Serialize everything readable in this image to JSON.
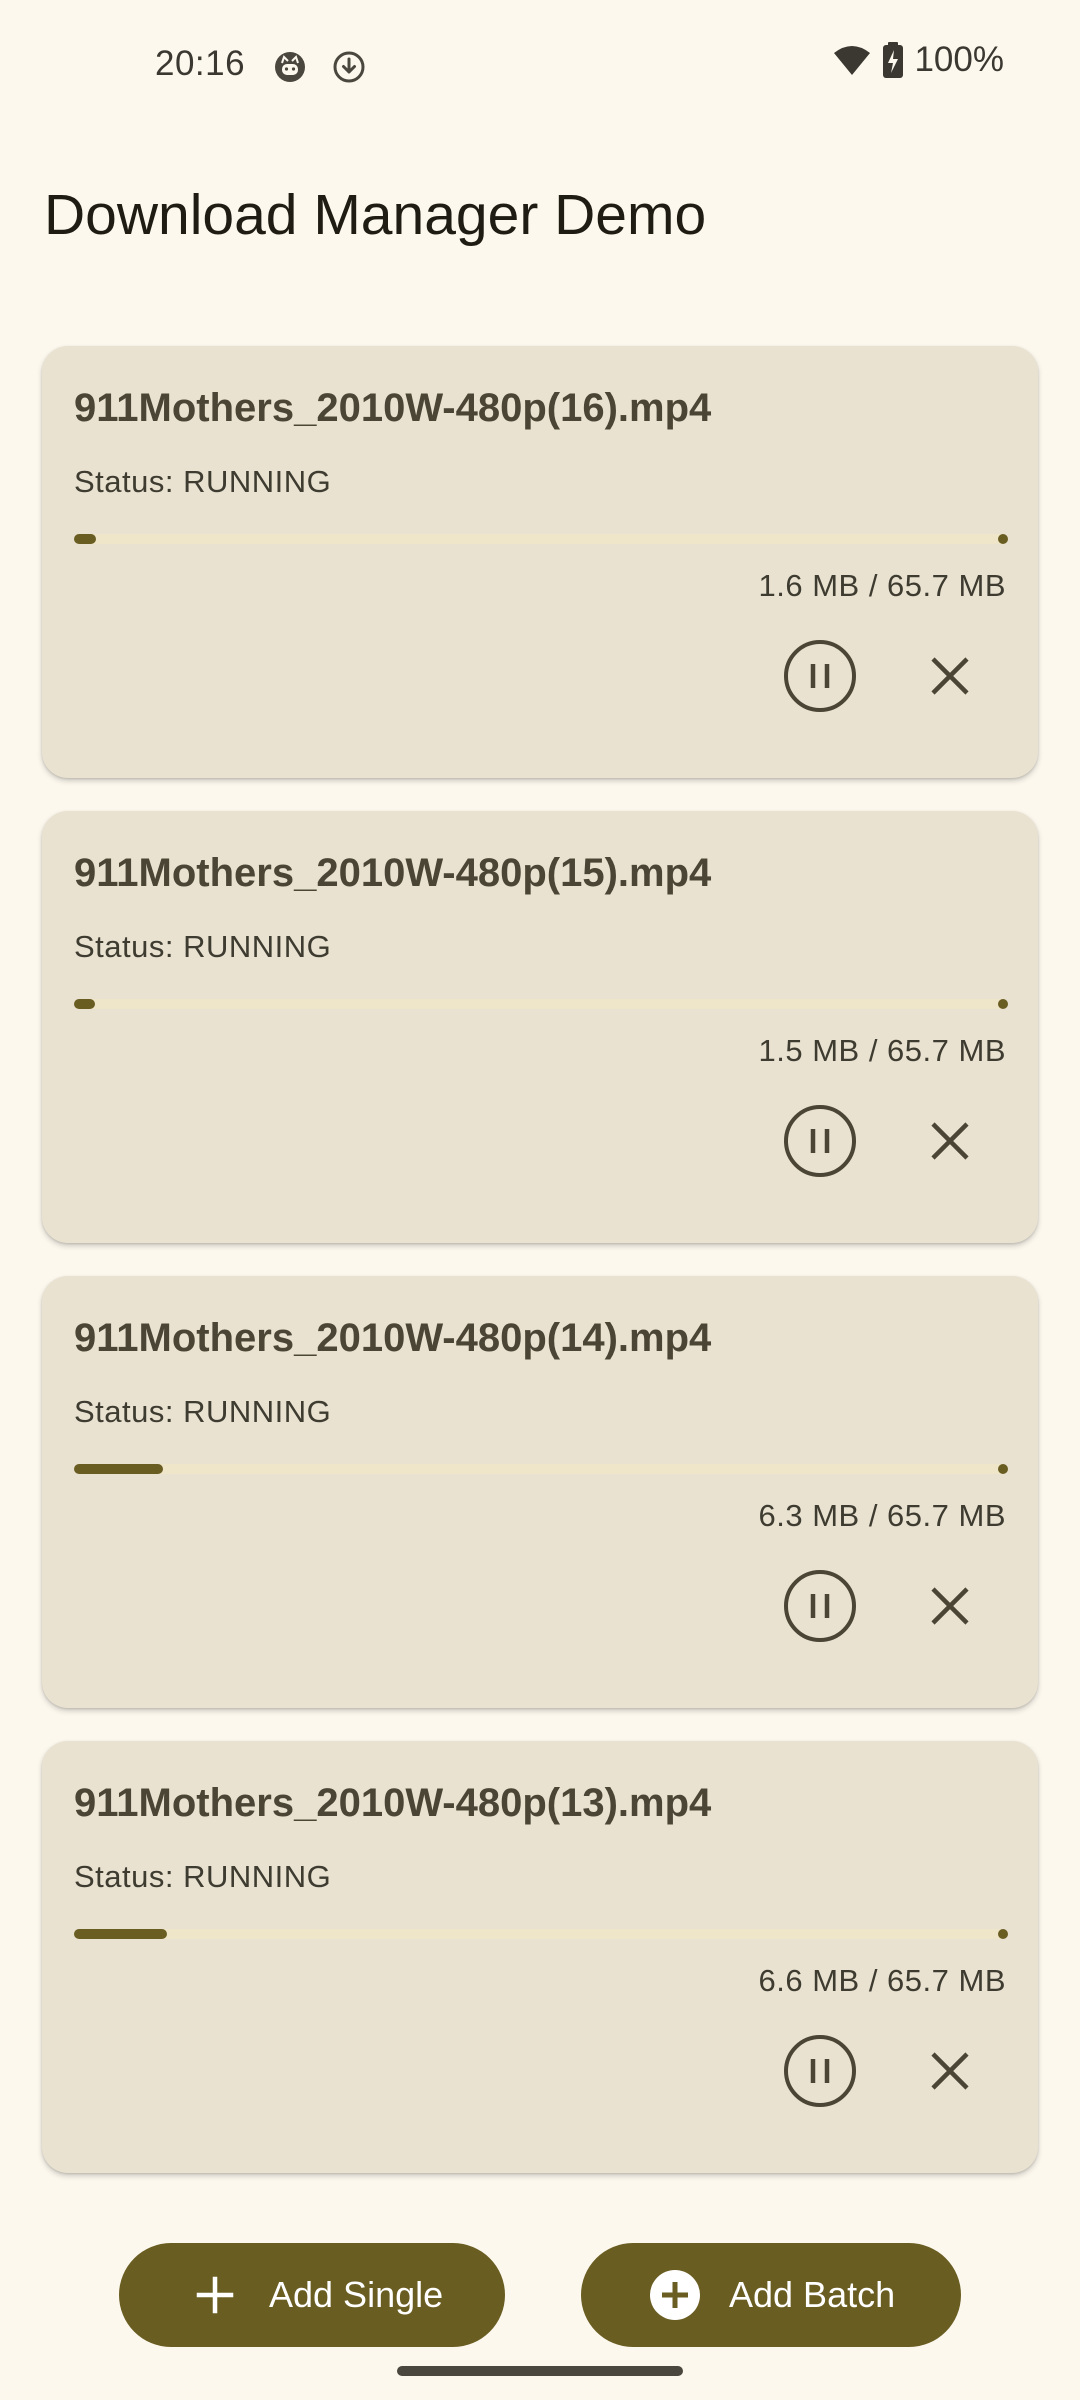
{
  "status_bar": {
    "time": "20:16",
    "notification_icons": [
      "cat-face-icon",
      "download-icon"
    ],
    "wifi_icon": "wifi-icon",
    "battery_icon": "battery-charging-icon",
    "battery_percent": "100%"
  },
  "app": {
    "title": "Download Manager Demo"
  },
  "downloads": [
    {
      "filename": "911Mothers_2010W-480p(16).mp4",
      "status": "Status: RUNNING",
      "size": "1.6 MB / 65.7 MB",
      "progress": 0.024,
      "pause_icon": "pause-circle-icon",
      "cancel_icon": "close-icon"
    },
    {
      "filename": "911Mothers_2010W-480p(15).mp4",
      "status": "Status: RUNNING",
      "size": "1.5 MB / 65.7 MB",
      "progress": 0.023,
      "pause_icon": "pause-circle-icon",
      "cancel_icon": "close-icon"
    },
    {
      "filename": "911Mothers_2010W-480p(14).mp4",
      "status": "Status: RUNNING",
      "size": "6.3 MB / 65.7 MB",
      "progress": 0.096,
      "pause_icon": "pause-circle-icon",
      "cancel_icon": "close-icon"
    },
    {
      "filename": "911Mothers_2010W-480p(13).mp4",
      "status": "Status: RUNNING",
      "size": "6.6 MB / 65.7 MB",
      "progress": 0.1,
      "pause_icon": "pause-circle-icon",
      "cancel_icon": "close-icon"
    }
  ],
  "actions": {
    "add_single_label": "Add Single",
    "add_single_icon": "plus-icon",
    "add_batch_label": "Add Batch",
    "add_batch_icon": "add-circle-icon"
  },
  "colors": {
    "background": "#FCF8EE",
    "card": "#E9E2D1",
    "accent": "#6A5D22",
    "track": "#EFE6C9",
    "text_primary": "#1E1C13",
    "icon": "#4A4535"
  }
}
